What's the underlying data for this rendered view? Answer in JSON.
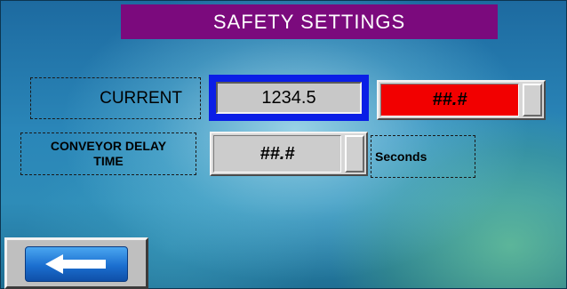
{
  "header": {
    "title": "SAFETY SETTINGS"
  },
  "current": {
    "label": "CURRENT",
    "value": "1234.5",
    "alarm_value": "##.#"
  },
  "conveyor_delay": {
    "label_line1": "CONVEYOR DELAY",
    "label_line2": "TIME",
    "value": "##.#",
    "unit": "Seconds"
  },
  "navigation": {
    "back_icon": "left-arrow-icon"
  },
  "colors": {
    "title_bar": "#7b0a7d",
    "alarm_field": "#f20000",
    "highlight_border": "#0a1ee6",
    "back_button": "#1b6fd0"
  }
}
